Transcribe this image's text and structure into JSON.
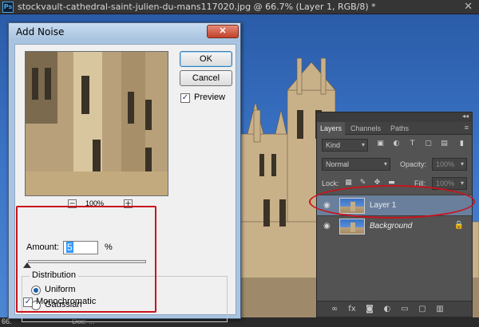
{
  "document": {
    "app_icon": "Ps",
    "title": "stockvault-cathedral-saint-julien-du-mans117020.jpg @ 66.7% (Layer 1, RGB/8) *",
    "close_glyph": "✕",
    "status_zoom": "66.",
    "status_doc": "Doc: ..."
  },
  "dialog": {
    "title": "Add Noise",
    "close_glyph": "✕",
    "ok_label": "OK",
    "cancel_label": "Cancel",
    "preview_label": "Preview",
    "preview_checked": true,
    "zoom_label": "100%",
    "zoom_out": "−",
    "zoom_in": "+",
    "amount_label": "Amount:",
    "amount_value": "5",
    "amount_unit": "%",
    "amount_slider_fraction": 0.0125,
    "distribution_label": "Distribution",
    "uniform_label": "Uniform",
    "uniform_selected": true,
    "gaussian_label": "Gaussian",
    "monochromatic_label": "Monochromatic",
    "monochromatic_checked": true,
    "check_glyph": "✓"
  },
  "layers_panel": {
    "collapse_glyph": "◂◂",
    "tabs": [
      {
        "label": "Layers",
        "active": true
      },
      {
        "label": "Channels",
        "active": false
      },
      {
        "label": "Paths",
        "active": false
      }
    ],
    "menu_glyph": "≡",
    "filter_label": "Kind",
    "blend_mode": "Normal",
    "opacity_label": "Opacity:",
    "opacity_value": "100%",
    "lock_label": "Lock:",
    "fill_label": "Fill:",
    "fill_value": "100%",
    "dropdown_arrow": "▾",
    "layers": [
      {
        "name": "Layer 1",
        "selected": true,
        "italic": false,
        "locked": false
      },
      {
        "name": "Background",
        "selected": false,
        "italic": true,
        "locked": true
      }
    ],
    "eye_glyph": "◉",
    "lock_glyph": "🔒"
  },
  "colors": {
    "highlight": "#c8141d",
    "selected_layer": "#6a7f9c",
    "dialog_frame": "#a9c4e0",
    "sky": "#3c75c8"
  }
}
